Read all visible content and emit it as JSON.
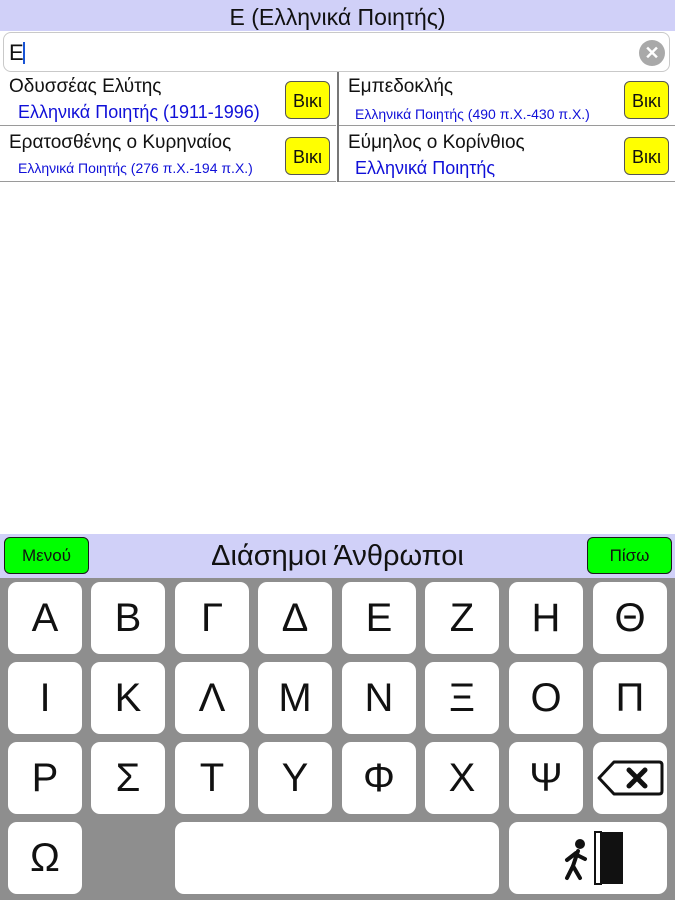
{
  "header": {
    "title": "Ε (Ελληνικά Ποιητής)"
  },
  "search": {
    "value": "Ε"
  },
  "results": [
    {
      "name": "Οδυσσέας Ελύτης",
      "subtitle": "Ελληνικά Ποιητής (1911-1996)",
      "button": "Βικι"
    },
    {
      "name": "Εμπεδοκλής",
      "subtitle": "Ελληνικά Ποιητής (490 π.Χ.-430 π.Χ.)",
      "button": "Βικι"
    },
    {
      "name": "Ερατοσθένης ο Κυρηναίος",
      "subtitle": "Ελληνικά Ποιητής (276 π.Χ.-194 π.Χ.)",
      "button": "Βικι"
    },
    {
      "name": "Εύμηλος ο Κορίνθιος",
      "subtitle": "Ελληνικά Ποιητής",
      "button": "Βικι"
    }
  ],
  "bottom_bar": {
    "title": "Διάσημοι Άνθρωποι",
    "menu_label": "Μενού",
    "back_label": "Πίσω"
  },
  "keyboard": {
    "rows": [
      [
        "Α",
        "Β",
        "Γ",
        "Δ",
        "Ε",
        "Ζ",
        "Η",
        "Θ"
      ],
      [
        "Ι",
        "Κ",
        "Λ",
        "Μ",
        "Ν",
        "Ξ",
        "Ο",
        "Π"
      ],
      [
        "Ρ",
        "Σ",
        "Τ",
        "Υ",
        "Φ",
        "Χ",
        "Ψ"
      ],
      [
        "Ω"
      ]
    ],
    "icons": {
      "delete": "backspace-icon",
      "exit": "exit-door-icon",
      "clear": "clear-icon"
    }
  },
  "colors": {
    "bar": "#d0d0f8",
    "wiki_button": "#ffff00",
    "nav_button": "#00ff00",
    "link": "#1010d8",
    "keyboard_bg": "#8e8e8e"
  }
}
